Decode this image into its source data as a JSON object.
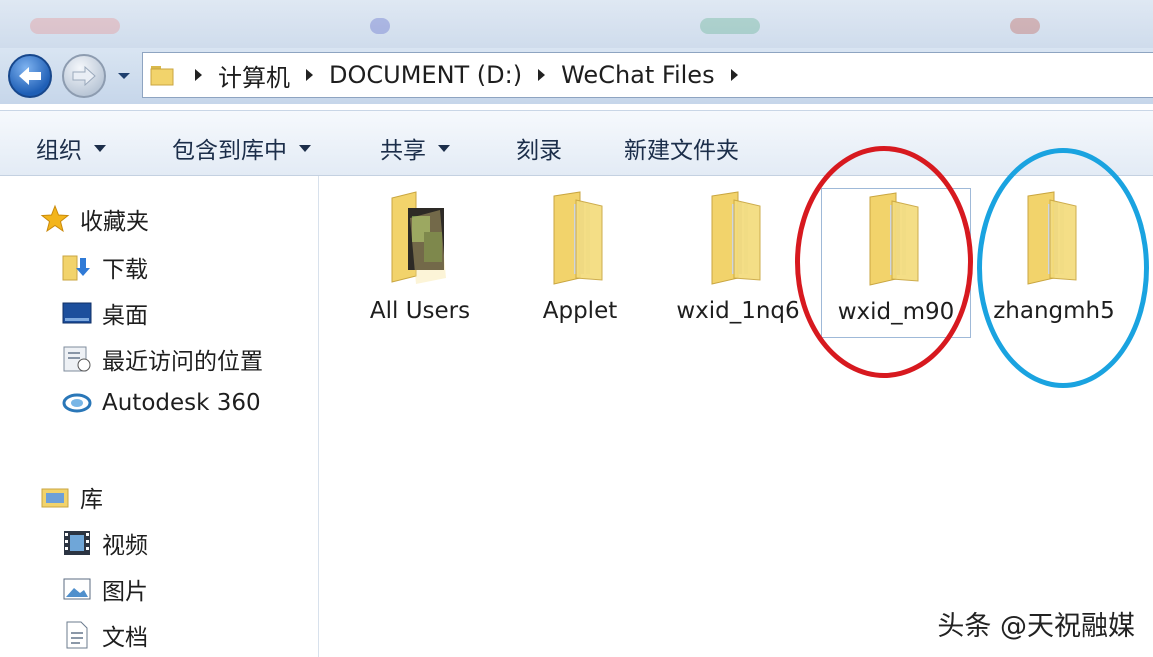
{
  "address_bar": {
    "breadcrumbs": [
      "计算机",
      "DOCUMENT (D:)",
      "WeChat Files"
    ]
  },
  "toolbar": {
    "organize": "组织",
    "include_in_library": "包含到库中",
    "share": "共享",
    "burn": "刻录",
    "new_folder": "新建文件夹"
  },
  "nav_pane": {
    "favorites": {
      "header": "收藏夹",
      "items": [
        "下载",
        "桌面",
        "最近访问的位置",
        "Autodesk 360"
      ]
    },
    "libraries": {
      "header": "库",
      "items": [
        "视频",
        "图片",
        "文档"
      ]
    }
  },
  "folders": [
    {
      "name": "All Users"
    },
    {
      "name": "Applet"
    },
    {
      "name": "wxid_1nq6"
    },
    {
      "name": "wxid_m90",
      "highlight": "#d7191f"
    },
    {
      "name": "zhangmh5",
      "highlight": "#1aa3e0"
    }
  ],
  "watermark": "头条 @天祝融媒",
  "colors": {
    "folder": "#f2d36b",
    "selection_border": "#9fb9d8",
    "red_circle": "#d7191f",
    "blue_circle": "#1aa3e0"
  },
  "icons": {
    "back": "back-arrow-icon",
    "forward": "forward-arrow-icon",
    "favorites": "star-icon",
    "libraries": "library-folder-icon"
  }
}
